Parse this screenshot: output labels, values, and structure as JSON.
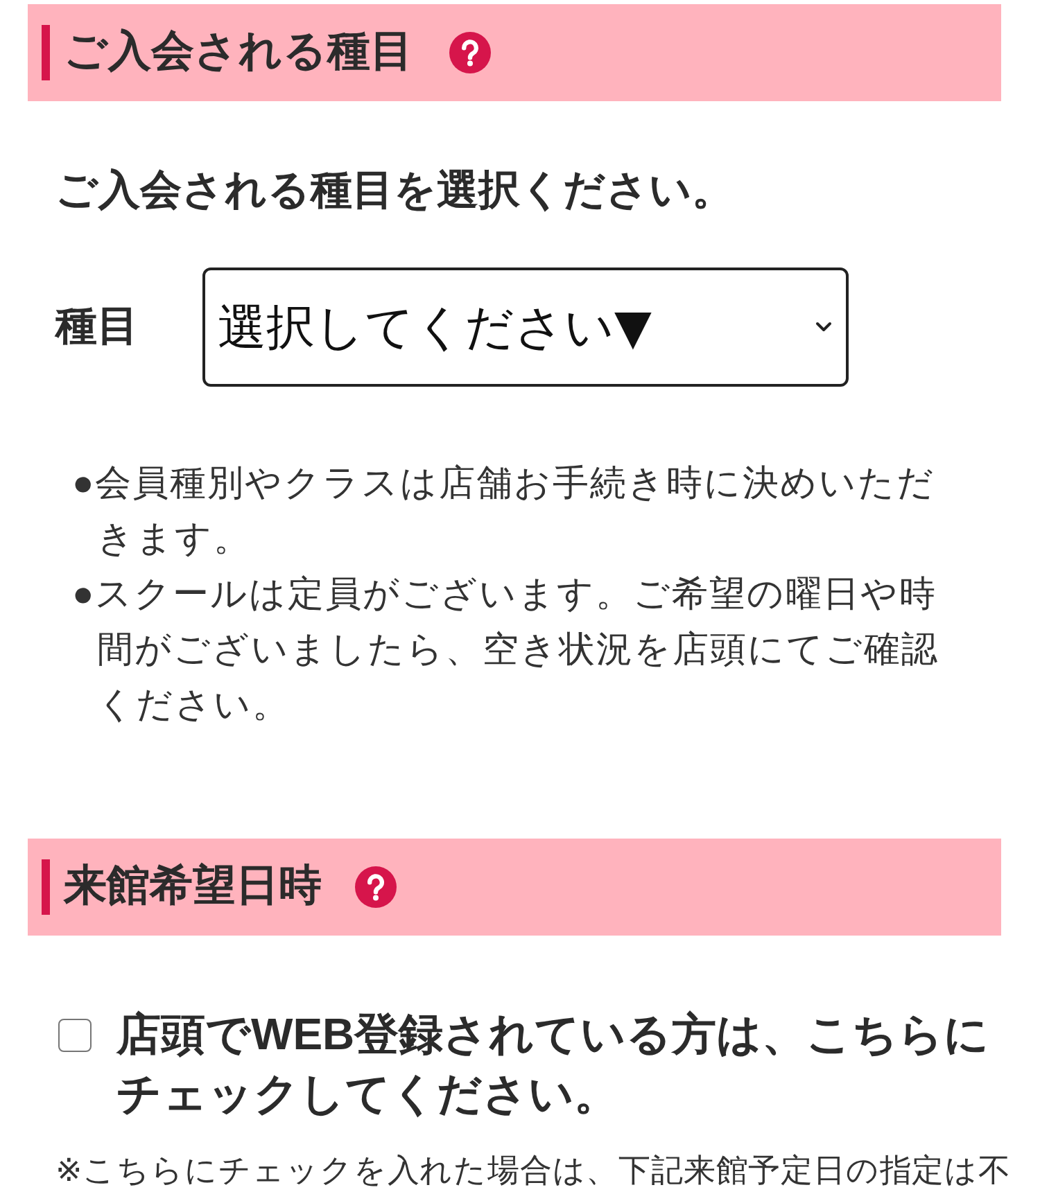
{
  "sections": [
    {
      "title": "ご入会される種目",
      "prompt": "ご入会される種目を選択ください。",
      "field": {
        "label": "種目",
        "value": "選択してください▼"
      },
      "notes": [
        "●会員種別やクラスは店舗お手続き時に決めいただきます。",
        "●スクールは定員がございます。ご希望の曜日や時間がございましたら、空き状況を店頭にてご確認ください。"
      ]
    },
    {
      "title": "来館希望日時",
      "checkbox": {
        "label": "店頭でWEB登録されている方は、こちらにチェックしてください。",
        "checked": false
      },
      "note": "※こちらにチェックを入れた場合は、下記来館予定日の指定は不"
    }
  ]
}
